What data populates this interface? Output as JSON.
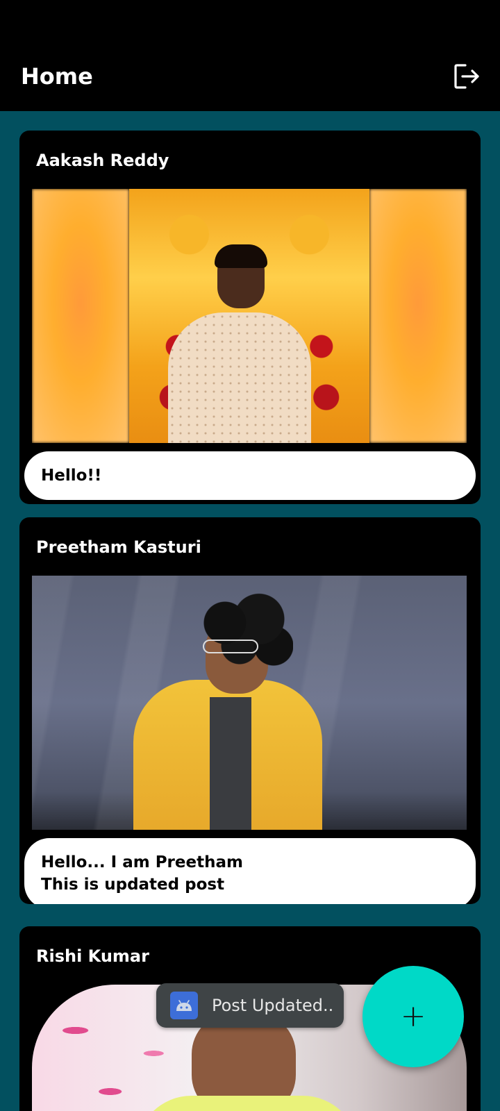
{
  "app_bar": {
    "title": "Home",
    "logout_icon": "logout-icon"
  },
  "posts": [
    {
      "author": "Aakash Reddy",
      "caption_lines": [
        "Hello!!"
      ]
    },
    {
      "author": "Preetham Kasturi",
      "caption_lines": [
        "Hello... I am Preetham",
        "This is updated post"
      ]
    },
    {
      "author": "Rishi Kumar",
      "caption_lines": []
    }
  ],
  "toast": {
    "icon": "android-icon",
    "text": "Post Updated.."
  },
  "fab": {
    "icon": "plus-icon",
    "label": "+"
  },
  "colors": {
    "background": "#02505f",
    "bar": "#000000",
    "fab": "#00d9c7",
    "toast": "#3f4446"
  }
}
